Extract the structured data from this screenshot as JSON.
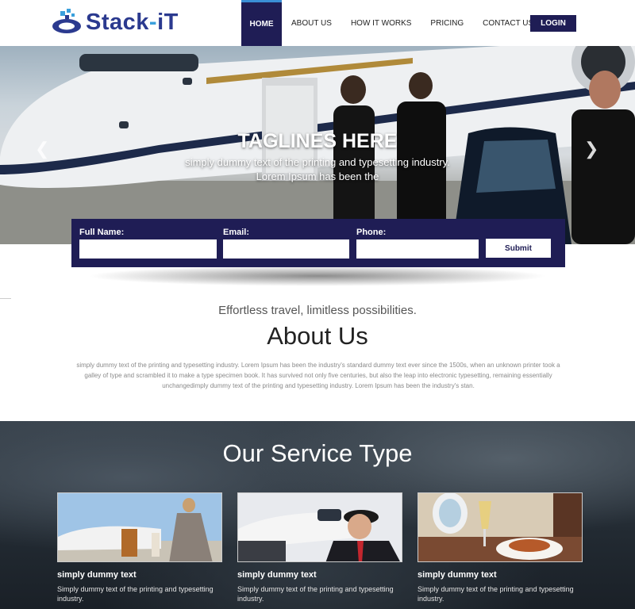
{
  "brand": {
    "name_part1": "Stack",
    "name_dash": "-",
    "name_part2": "iT"
  },
  "nav": {
    "items": [
      {
        "label": "HOME"
      },
      {
        "label": "ABOUT US"
      },
      {
        "label": "HOW IT WORKS"
      },
      {
        "label": "PRICING"
      },
      {
        "label": "CONTACT US"
      }
    ],
    "login_label": "LOGIN"
  },
  "hero": {
    "title": "TAGLINES HERE",
    "subtitle_line1": "simply dummy text of the printing and typesetting industry.",
    "subtitle_line2": "Lorem Ipsum has been the",
    "prev_icon": "chevron-left-icon",
    "next_icon": "chevron-right-icon"
  },
  "form": {
    "name_label": "Full Name:",
    "email_label": "Email:",
    "phone_label": "Phone:",
    "name_value": "",
    "email_value": "",
    "phone_value": "",
    "submit_label": "Submit"
  },
  "about": {
    "tagline": "Effortless travel, limitless possibilities.",
    "title": "About Us",
    "body_line1": "simply dummy text of the printing and typesetting industry. Lorem Ipsum has been the industry's standard dummy text ever since the 1500s, when an unknown printer took a",
    "body_line2": "galley of type and scrambled it to make a type specimen book. It has survived not only five centuries, but also the leap into electronic typesetting, remaining essentially",
    "body_line3": "unchangedimply dummy text of the printing and typesetting industry. Lorem Ipsum has been the industry's stan."
  },
  "services": {
    "title": "Our Service Type",
    "cards": [
      {
        "title": "simply dummy text",
        "text": "Simply dummy text of the printing and typesetting industry."
      },
      {
        "title": "simply dummy text",
        "text": "Simply dummy text of the printing and typesetting industry."
      },
      {
        "title": "simply dummy text",
        "text": "Simply dummy text of the printing and typesetting industry."
      }
    ]
  },
  "colors": {
    "primary": "#1f1d55",
    "accent": "#3a8fd6",
    "logo": "#2b3a8f"
  }
}
